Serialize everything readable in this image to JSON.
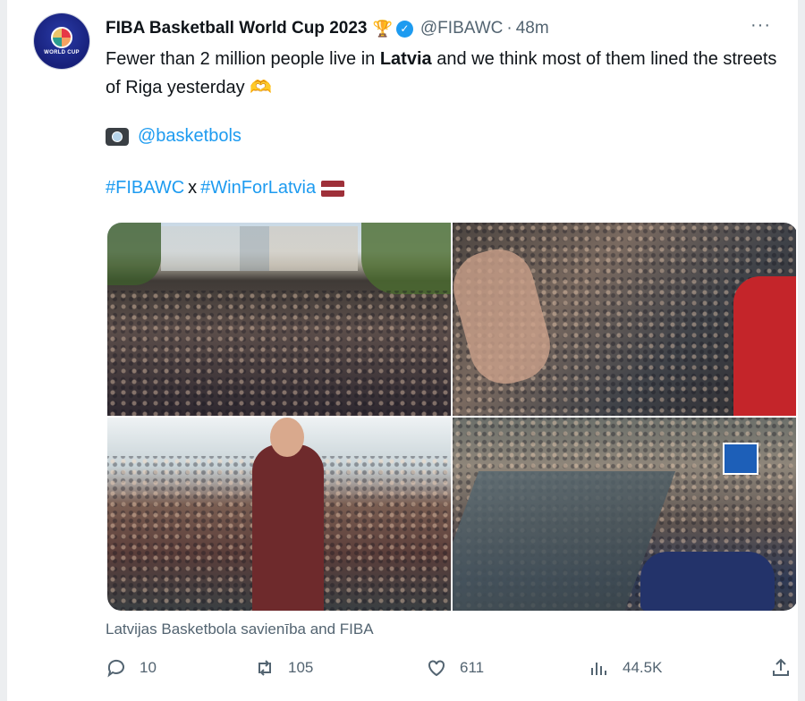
{
  "tweet": {
    "author_name": "FIBA Basketball World Cup 2023",
    "trophy_icon": "trophy-icon",
    "verified_icon": "verified-badge-icon",
    "handle": "@FIBAWC",
    "separator": "·",
    "time": "48m",
    "more_label": "···",
    "text_part1": "Fewer than 2 million people live in ",
    "text_bold": "Latvia",
    "text_part2": " and we think most of them lined the streets of Riga yesterday",
    "text_emoji": "🫶",
    "credit_handle": "@basketbols",
    "hashtag1": "#FIBAWC",
    "hashtag_sep": "x",
    "hashtag2": "#WinForLatvia",
    "caption": "Latvijas Basketbola savienība and FIBA"
  },
  "avatar": {
    "label": "WORLD CUP"
  },
  "actions": {
    "replies": "10",
    "retweets": "105",
    "likes": "611",
    "views": "44.5K"
  },
  "colors": {
    "link": "#1d9bf0",
    "muted": "#536471",
    "flag_red": "#9e3039"
  }
}
